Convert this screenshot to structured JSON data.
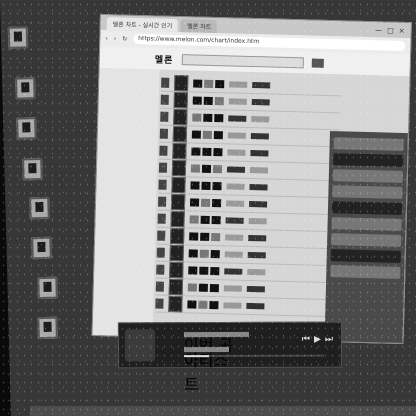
{
  "browser": {
    "tabs": [
      "멜론 차트 - 실시간 인기",
      "멜론 차트"
    ],
    "url": "https://www.melon.com/chart/index.htm",
    "site_logo": "멜론"
  },
  "player": {
    "track_title": "이번 곡",
    "artist": "아티스트",
    "progress": 0.18
  },
  "icons": {
    "back": "back-icon",
    "forward": "forward-icon",
    "reload": "reload-icon",
    "search": "search-icon"
  }
}
